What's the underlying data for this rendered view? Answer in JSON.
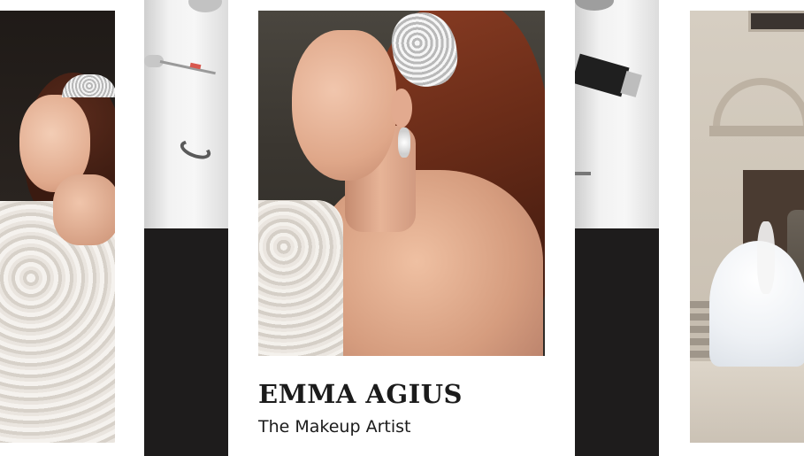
{
  "card": {
    "name": "EMMA AGIUS",
    "subtitle": "The Makeup Artist"
  },
  "panels": [
    {
      "id": "left-photo",
      "subject": "bride-laughing"
    },
    {
      "id": "product-strip-1",
      "subject": "makeup-products"
    },
    {
      "id": "main-photo",
      "subject": "bride-profile"
    },
    {
      "id": "product-strip-2",
      "subject": "makeup-brush"
    },
    {
      "id": "right-photo",
      "subject": "couple-at-church"
    }
  ],
  "colors": {
    "background": "#ffffff",
    "dark_band": "#1e1c1c",
    "text": "#1b1b1b"
  }
}
